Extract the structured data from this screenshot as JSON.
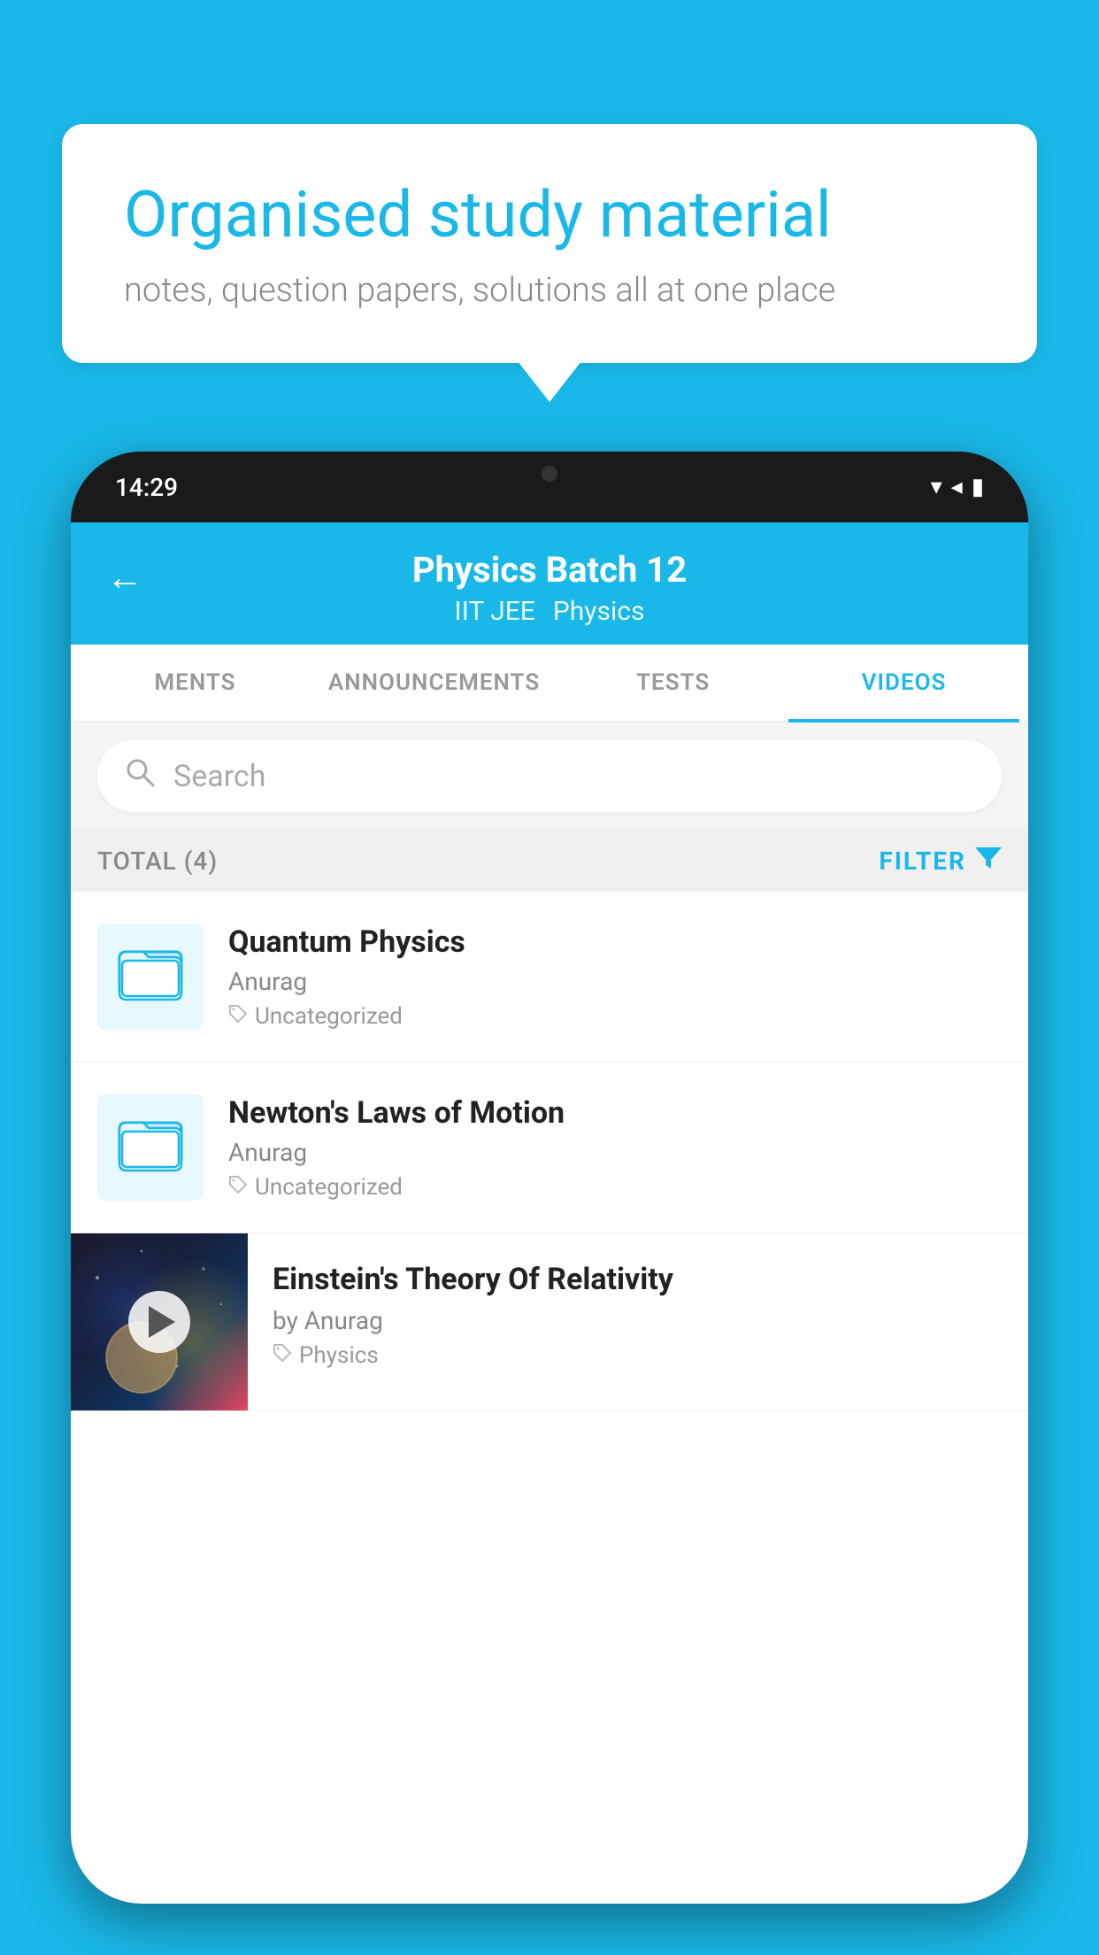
{
  "background": {
    "color": "#1ab8e8"
  },
  "speech_bubble": {
    "headline": "Organised study material",
    "subtext": "notes, question papers, solutions all at one place"
  },
  "phone": {
    "status_bar": {
      "time": "14:29"
    },
    "header": {
      "back_label": "←",
      "title": "Physics Batch 12",
      "subtitle1": "IIT JEE",
      "subtitle2": "Physics"
    },
    "tabs": [
      {
        "label": "MENTS",
        "active": false
      },
      {
        "label": "ANNOUNCEMENTS",
        "active": false
      },
      {
        "label": "TESTS",
        "active": false
      },
      {
        "label": "VIDEOS",
        "active": true
      }
    ],
    "search": {
      "placeholder": "Search"
    },
    "filter_row": {
      "total_label": "TOTAL (4)",
      "filter_label": "FILTER"
    },
    "videos": [
      {
        "title": "Quantum Physics",
        "author": "Anurag",
        "tag": "Uncategorized",
        "type": "folder"
      },
      {
        "title": "Newton's Laws of Motion",
        "author": "Anurag",
        "tag": "Uncategorized",
        "type": "folder"
      },
      {
        "title": "Einstein's Theory Of Relativity",
        "author": "by Anurag",
        "tag": "Physics",
        "type": "video"
      }
    ]
  }
}
